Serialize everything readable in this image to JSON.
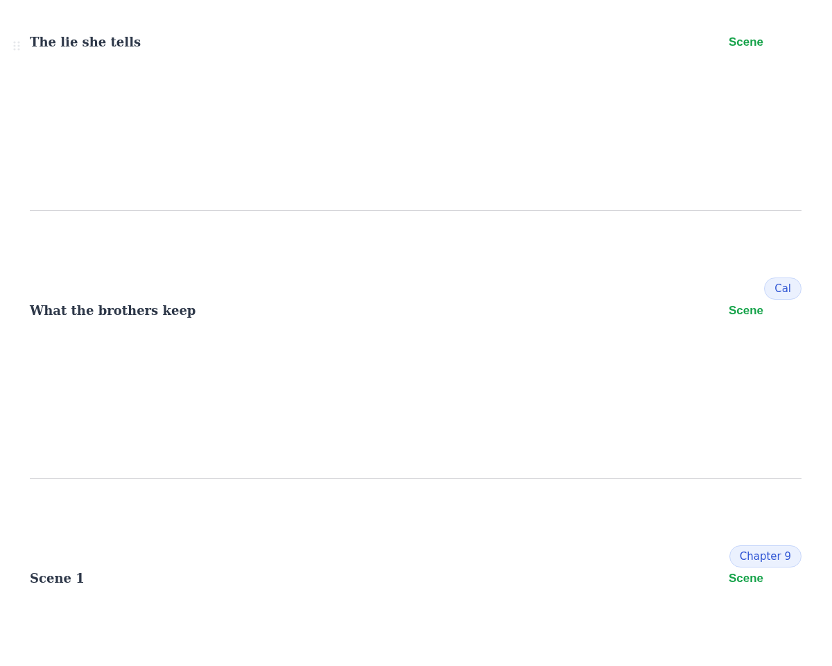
{
  "scenes": [
    {
      "title": "The lie she tells",
      "type": "Scene",
      "drag_handle": true
    },
    {
      "title": "What the brothers keep",
      "type": "Scene",
      "tag": "Cal",
      "drag_handle": false
    },
    {
      "title": "Scene 1",
      "type": "Scene",
      "tag": "Chapter 9",
      "drag_handle": false
    }
  ]
}
